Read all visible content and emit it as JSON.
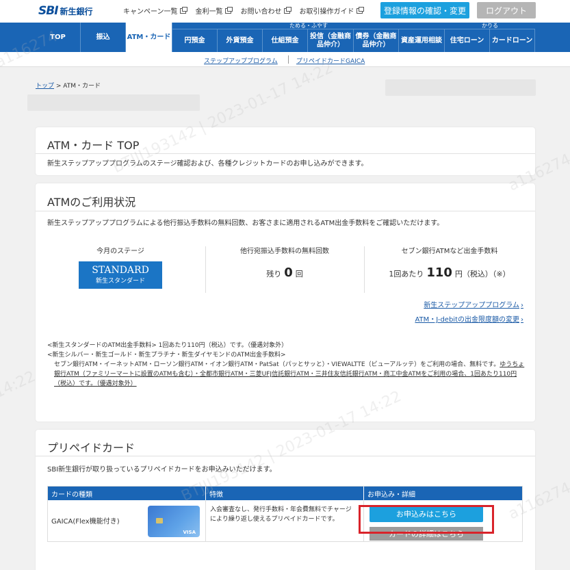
{
  "header": {
    "logo_sbi": "SBI",
    "logo_name": "新生銀行",
    "links": [
      "キャンペーン一覧",
      "金利一覧",
      "お問い合わせ",
      "お取引操作ガイド"
    ],
    "register_button": "登録情報の確認・変更",
    "logout_button": "ログアウト"
  },
  "nav": {
    "group_save": "ためる・ふやす",
    "group_borrow": "かりる",
    "items": [
      "TOP",
      "振込",
      "ATM・カード",
      "円預金",
      "外貨預金",
      "仕組預金",
      "投信（金融商品仲介）",
      "債券（金融商品仲介）",
      "資産運用相談",
      "住宅ローン",
      "カードローン"
    ]
  },
  "subnav": {
    "links": [
      "ステップアッププログラム",
      "プリペイドカードGAICA"
    ]
  },
  "breadcrumb": {
    "home": "トップ",
    "current": "> ATM・カード"
  },
  "card_top": {
    "title": "ATM・カード TOP",
    "desc": "新生ステップアッププログラムのステージ確認および、各種クレジットカードのお申し込みができます。"
  },
  "card_atm": {
    "title": "ATMのご利用状況",
    "desc": "新生ステップアッププログラムによる他行振込手数料の無料回数、お客さまに適用されるATM出金手数料をご確認いただけます。",
    "stage_label": "今月のステージ",
    "stage_en": "STANDARD",
    "stage_jp": "新生スタンダード",
    "free_label": "他行宛振込手数料の無料回数",
    "free_prefix": "残り",
    "free_value": "0",
    "free_suffix": "回",
    "fee_label": "セブン銀行ATMなど出金手数料",
    "fee_prefix": "1回あたり",
    "fee_value": "110",
    "fee_suffix": "円（税込）（※）",
    "link1": "新生ステップアッププログラム",
    "link2": "ATM・J-debitの出金限度額の変更",
    "note1": "<新生スタンダードのATM出金手数料> 1回あたり110円（税込）です。（優遇対象外）",
    "note2": "<新生シルバー・新生ゴールド・新生プラチナ・新生ダイヤモンドのATM出金手数料>",
    "note3": "セブン銀行ATM・イーネットATM・ローソン銀行ATM・イオン銀行ATM・PatSat（パッとサッと）・VIEWALTTE（ビューアルッテ）をご利用の場合、無料です。",
    "note4": "ゆうちょ銀行ATM（ファミリーマートに設置のATMも含む）・全都市銀行ATM・三菱UFJ信託銀行ATM・三井住友信託銀行ATM・商工中金ATM",
    "note5": "をご利用の場合、1回あたり110円（税込）です。（優遇対象外）"
  },
  "card_prepaid": {
    "title": "プリペイドカード",
    "desc": "SBI新生銀行が取り扱っているプリペイドカードをお申込みいただけます。",
    "col1": "カードの種類",
    "col2": "特徴",
    "col3": "お申込み・詳細",
    "row_name": "GAICA(Flex機能付き)",
    "row_feature": "入会審査なし、発行手数料・年会費無料でチャージにより繰り返し使えるプリペイドカードです。",
    "apply_button": "お申込みはこちら",
    "detail_button": "カードの詳細はこちら",
    "card_brand": "VISA"
  },
  "watermarks": [
    "a116274",
    "BTJJJ193142 | 2023-01-17 14:22",
    "a116274",
    "14:22",
    "BTJJJ193142 | 2023-01-17 14:22",
    "a116274"
  ],
  "colors": {
    "brand": "#1a65b5",
    "accent": "#1ca0de",
    "highlight": "#d9232a"
  }
}
